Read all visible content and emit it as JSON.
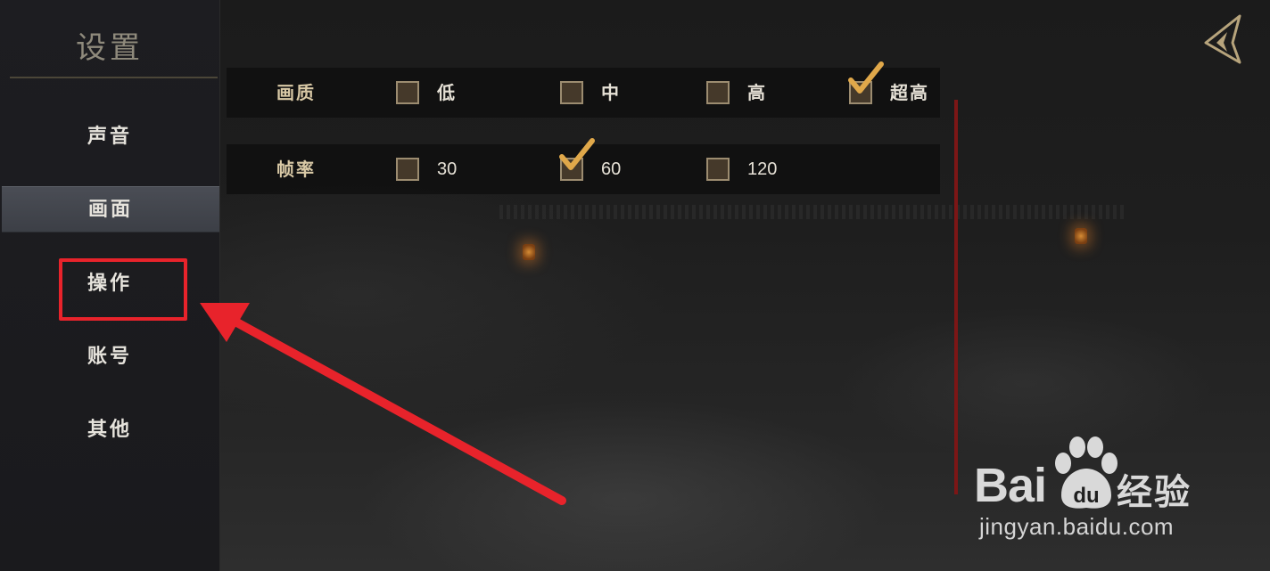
{
  "sidebar": {
    "title": "设置",
    "items": [
      {
        "label": "声音",
        "active": false
      },
      {
        "label": "画面",
        "active": true
      },
      {
        "label": "操作",
        "active": false,
        "highlighted": true
      },
      {
        "label": "账号",
        "active": false
      },
      {
        "label": "其他",
        "active": false
      }
    ]
  },
  "settings": {
    "quality": {
      "label": "画质",
      "options": [
        {
          "label": "低",
          "checked": false
        },
        {
          "label": "中",
          "checked": false
        },
        {
          "label": "高",
          "checked": false
        },
        {
          "label": "超高",
          "checked": true
        }
      ]
    },
    "framerate": {
      "label": "帧率",
      "options": [
        {
          "label": "30",
          "checked": false
        },
        {
          "label": "60",
          "checked": true
        },
        {
          "label": "120",
          "checked": false
        }
      ]
    }
  },
  "watermark": {
    "brand_left": "Bai",
    "brand_du": "du",
    "brand_cn": "经验",
    "url": "jingyan.baidu.com"
  },
  "colors": {
    "accent_gold": "#d9c9a6",
    "check_gold": "#e0a84a",
    "annotation_red": "#e8232b",
    "scroll_red": "#7c1616"
  },
  "icons": {
    "back": "back-arrow-icon",
    "check": "checkmark-icon"
  }
}
